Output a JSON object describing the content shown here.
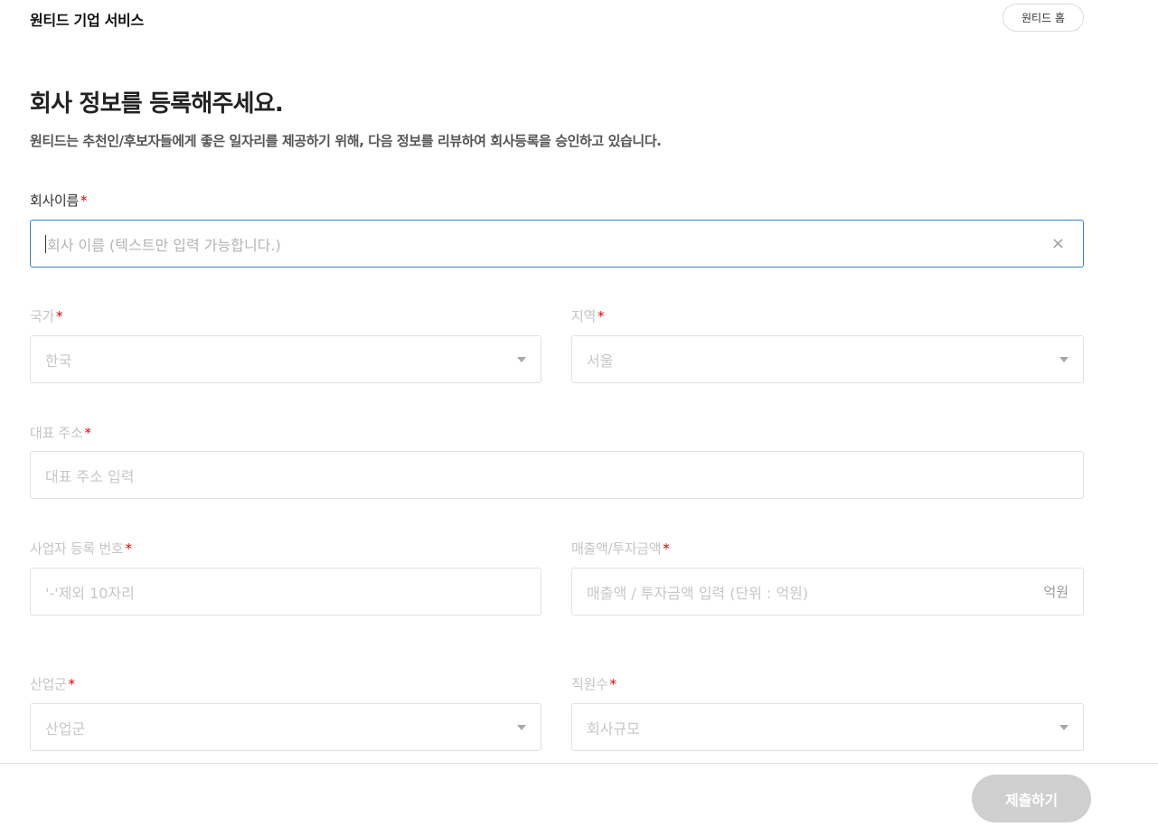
{
  "header": {
    "brand": "원티드 기업 서비스",
    "home_button": "원티드 홈"
  },
  "page": {
    "title": "회사 정보를 등록해주세요.",
    "subtitle": "원티드는 추천인/후보자들에게 좋은 일자리를 제공하기 위해, 다음 정보를 리뷰하여 회사등록을 승인하고 있습니다."
  },
  "form": {
    "required_mark": "*",
    "company_name": {
      "label": "회사이름",
      "placeholder": "회사 이름 (텍스트만 입력 가능합니다.)",
      "clear_icon": "×"
    },
    "country": {
      "label": "국가",
      "value": "한국"
    },
    "region": {
      "label": "지역",
      "value": "서울"
    },
    "address": {
      "label": "대표 주소",
      "placeholder": "대표 주소 입력"
    },
    "business_number": {
      "label": "사업자 등록 번호",
      "placeholder": "'-'제외 10자리"
    },
    "revenue": {
      "label": "매출액/투자금액",
      "placeholder": "매출액 / 투자금액 입력 (단위 : 억원)",
      "unit": "억원"
    },
    "industry": {
      "label": "산업군",
      "value": "산업군"
    },
    "employees": {
      "label": "직원수",
      "value": "회사규모"
    }
  },
  "footer": {
    "submit_button": "제출하기"
  },
  "colors": {
    "required": "#e00000",
    "focus_border": "#3b82b8",
    "submit_disabled": "#cfcfcf"
  },
  "icons": {
    "clear": "close-icon",
    "dropdown": "chevron-down-icon"
  }
}
